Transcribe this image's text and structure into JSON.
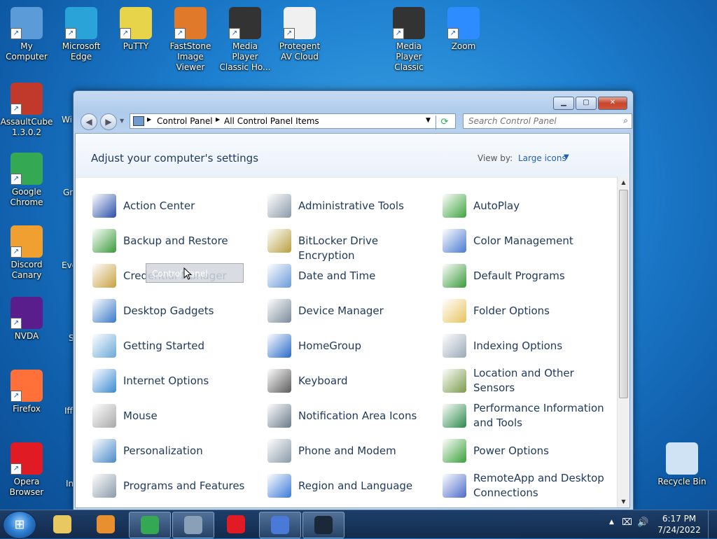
{
  "desktop": {
    "icons": [
      {
        "label": "My Computer",
        "color": "#5a9bd8"
      },
      {
        "label": "Microsoft Edge",
        "color": "#2aa4d8"
      },
      {
        "label": "PuTTY",
        "color": "#e8d44a"
      },
      {
        "label": "FastStone Image Viewer",
        "color": "#e07a2a"
      },
      {
        "label": "Media Player Classic Ho...",
        "color": "#333333"
      },
      {
        "label": "Protegent  AV Cloud",
        "color": "#f0f0f0"
      },
      {
        "label": "Media Player Classic",
        "color": "#333333"
      },
      {
        "label": "Zoom",
        "color": "#2d8cff"
      },
      {
        "label": "AssaultCube 1.3.0.2",
        "color": "#c0392b"
      },
      {
        "label": "Google Chrome",
        "color": "#34a853"
      },
      {
        "label": "Discord Canary",
        "color": "#f0a030"
      },
      {
        "label": "NVDA",
        "color": "#5a1e8c"
      },
      {
        "label": "Firefox",
        "color": "#ff7139"
      },
      {
        "label": "Opera Browser",
        "color": "#e01b24"
      },
      {
        "label": "Recycle Bin",
        "color": "#cfe3f5"
      }
    ],
    "partials": [
      "Wi",
      "Gre",
      "Eve",
      "S",
      "Iff",
      "In"
    ]
  },
  "window": {
    "breadcrumbs": [
      "Control Panel",
      "All Control Panel Items"
    ],
    "search_placeholder": "Search Control Panel",
    "header_title": "Adjust your computer's settings",
    "view_by_label": "View by:",
    "view_by_value": "Large icons",
    "items": [
      {
        "label": "Action Center",
        "color": "#2a4fa8"
      },
      {
        "label": "Administrative Tools",
        "color": "#8a9aa8"
      },
      {
        "label": "AutoPlay",
        "color": "#3fa33f"
      },
      {
        "label": "Backup and Restore",
        "color": "#3a9a3a"
      },
      {
        "label": "BitLocker Drive Encryption",
        "color": "#b8a040"
      },
      {
        "label": "Color Management",
        "color": "#4a7ad0"
      },
      {
        "label": "Credential Manager",
        "color": "#c8a040"
      },
      {
        "label": "Date and Time",
        "color": "#6a9ad8"
      },
      {
        "label": "Default Programs",
        "color": "#3a9a3a"
      },
      {
        "label": "Desktop Gadgets",
        "color": "#3a7ac8"
      },
      {
        "label": "Device Manager",
        "color": "#7a8a9a"
      },
      {
        "label": "Folder Options",
        "color": "#e8c460"
      },
      {
        "label": "Getting Started",
        "color": "#6aa8d8"
      },
      {
        "label": "HomeGroup",
        "color": "#2a6ac8"
      },
      {
        "label": "Indexing Options",
        "color": "#9aa8b8"
      },
      {
        "label": "Internet Options",
        "color": "#3a8ad0"
      },
      {
        "label": "Keyboard",
        "color": "#5a5a5a"
      },
      {
        "label": "Location and Other Sensors",
        "color": "#7a9a4a"
      },
      {
        "label": "Mouse",
        "color": "#a8a8a8"
      },
      {
        "label": "Notification Area Icons",
        "color": "#6a7a8a"
      },
      {
        "label": "Performance Information and Tools",
        "color": "#2a8a4a"
      },
      {
        "label": "Personalization",
        "color": "#4a8ac8"
      },
      {
        "label": "Phone and Modem",
        "color": "#8a9aa8"
      },
      {
        "label": "Power Options",
        "color": "#3aa03a"
      },
      {
        "label": "Programs and Features",
        "color": "#8a9aaa"
      },
      {
        "label": "Region and Language",
        "color": "#3a7ad8"
      },
      {
        "label": "RemoteApp and Desktop Connections",
        "color": "#4a6ac8"
      }
    ],
    "drag_tooltip": "Control Panel"
  },
  "taskbar": {
    "apps": [
      {
        "name": "explorer",
        "color": "#e8c860"
      },
      {
        "name": "media-player",
        "color": "#e89030"
      },
      {
        "name": "chrome",
        "color": "#34a853"
      },
      {
        "name": "control-panel",
        "color": "#8aa0b8"
      },
      {
        "name": "opera",
        "color": "#e01b24"
      },
      {
        "name": "browser",
        "color": "#4a7ad8"
      },
      {
        "name": "steam",
        "color": "#1b2838"
      }
    ],
    "time": "6:17 PM",
    "date": "7/24/2022"
  }
}
